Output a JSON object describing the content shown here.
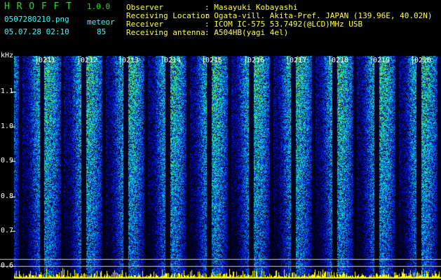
{
  "app": {
    "name": "H R O F F T",
    "version": "1.0.0",
    "filename": "0507280210.png",
    "datetime": "05.07.28 02:10",
    "count_label": "meteor",
    "count_value": "85"
  },
  "info": {
    "labels": [
      "Observer",
      "Receiving Location",
      "Receiver",
      "Receiving antenna"
    ],
    "values": [
      ": Masayuki Kobayashi",
      ": Ogata-vill. Akita-Pref. JAPAN (139.96E, 40.02N)",
      ": ICOM IC-575 53.7492(@LCD)MHz USB",
      ": A504HB(yagi 4el)"
    ]
  },
  "axis": {
    "unit": "kHz",
    "y_ticks": [
      "1.1",
      "1.0",
      "0.9",
      "0.8",
      "0.7",
      "0.6"
    ],
    "time_labels": [
      "0211",
      "0212",
      "0213",
      "0214",
      "0215",
      "0216",
      "0217",
      "0218",
      "0219",
      "0220"
    ]
  },
  "colors": {
    "background": "#000000",
    "title": "#22dd22",
    "filename": "#33ffff",
    "info": "#ffff44"
  }
}
